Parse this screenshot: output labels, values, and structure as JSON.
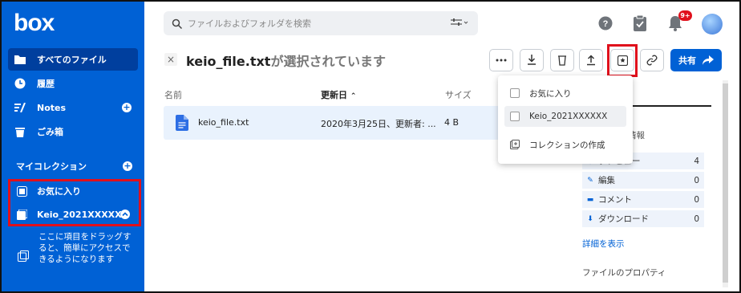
{
  "app": {
    "logo": "box"
  },
  "sidebar": {
    "nav": [
      {
        "label": "すべてのファイル",
        "icon": "folder-icon",
        "active": true
      },
      {
        "label": "履歴",
        "icon": "clock-icon"
      },
      {
        "label": "Notes",
        "icon": "notes-icon"
      },
      {
        "label": "ごみ箱",
        "icon": "trash-icon"
      }
    ],
    "collections_label": "マイコレクション",
    "collections": [
      {
        "label": "お気に入り",
        "icon": "favorite-icon"
      },
      {
        "label": "Keio_2021XXXXXX",
        "icon": "collection-icon"
      }
    ],
    "drag_hint": "ここに項目をドラッグすると、簡単にアクセスできるようになります"
  },
  "search": {
    "placeholder": "ファイルおよびフォルダを検索"
  },
  "topbar": {
    "notification_badge": "9+"
  },
  "selection": {
    "filename": "keio_file.txt",
    "suffix": "が選択されています"
  },
  "toolbar": {
    "share_label": "共有"
  },
  "file_list": {
    "headers": {
      "name": "名前",
      "updated": "更新日",
      "size": "サイズ"
    },
    "sort_arrow": "⌃",
    "rows": [
      {
        "name": "keio_file.txt",
        "updated": "2020年3月25日、更新者: ...",
        "size": "4 B"
      }
    ]
  },
  "dropdown": {
    "items": [
      {
        "label": "お気に入り"
      },
      {
        "label": "Keio_2021XXXXXX"
      }
    ],
    "create_label": "コレクションの作成"
  },
  "right_panel": {
    "section_label": "情報",
    "stats": [
      {
        "label": "プレビュー",
        "value": "4"
      },
      {
        "label": "編集",
        "value": "0"
      },
      {
        "label": "コメント",
        "value": "0"
      },
      {
        "label": "ダウンロード",
        "value": "0"
      }
    ],
    "details_link": "詳細を表示",
    "properties_label": "ファイルのプロパティ"
  },
  "colors": {
    "brand": "#0061d5",
    "highlight": "#e0101c",
    "selected_row": "#e9f2fd"
  }
}
